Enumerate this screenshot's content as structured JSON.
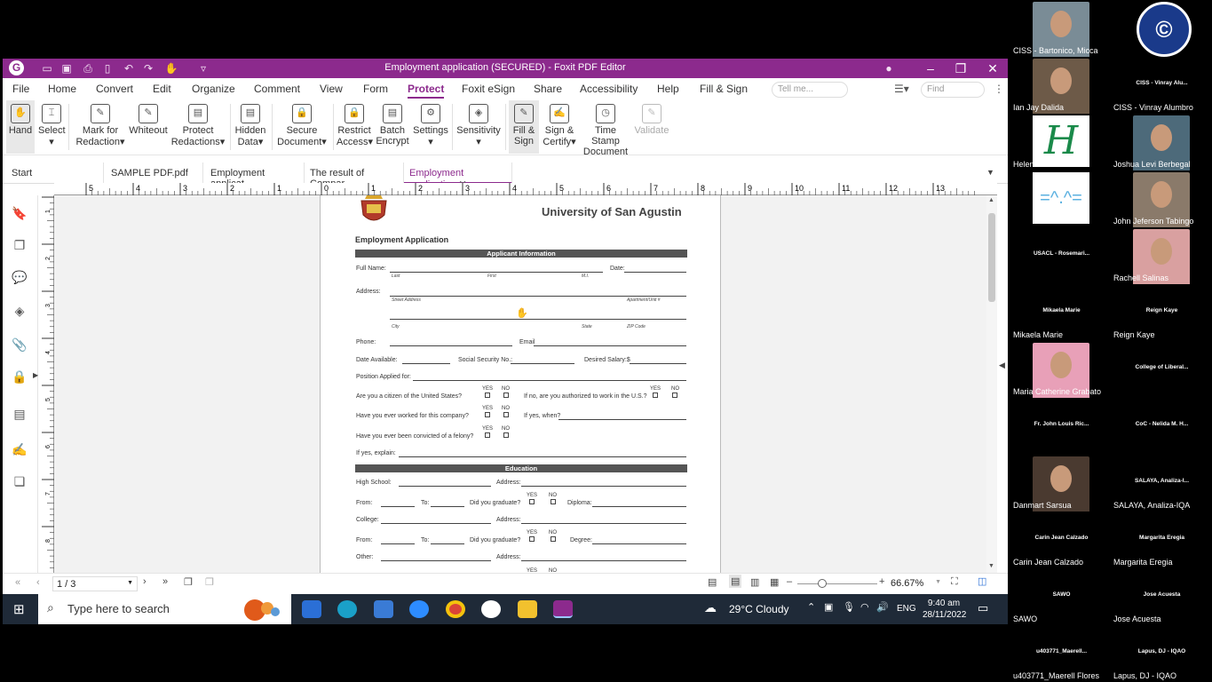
{
  "window": {
    "title": "Employment application (SECURED) - Foxit PDF Editor"
  },
  "menu": [
    "File",
    "Home",
    "Convert",
    "Edit",
    "Organize",
    "Comment",
    "View",
    "Form",
    "Protect",
    "Foxit eSign",
    "Share",
    "Accessibility",
    "Help",
    "Fill & Sign"
  ],
  "menu_active": "Protect",
  "tell_me": "Tell me...",
  "find": "Find",
  "ribbon": [
    {
      "l1": "Hand",
      "l2": ""
    },
    {
      "l1": "Select",
      "l2": "▾"
    },
    {
      "l1": "Mark for",
      "l2": "Redaction▾"
    },
    {
      "l1": "Whiteout",
      "l2": ""
    },
    {
      "l1": "Protect",
      "l2": "Redactions▾"
    },
    {
      "l1": "Hidden",
      "l2": "Data▾"
    },
    {
      "l1": "Secure",
      "l2": "Document▾"
    },
    {
      "l1": "Restrict",
      "l2": "Access▾"
    },
    {
      "l1": "Batch",
      "l2": "Encrypt"
    },
    {
      "l1": "Settings",
      "l2": "▾"
    },
    {
      "l1": "Sensitivity",
      "l2": "▾"
    },
    {
      "l1": "Fill &",
      "l2": "Sign"
    },
    {
      "l1": "Sign &",
      "l2": "Certify▾"
    },
    {
      "l1": "Time Stamp",
      "l2": "Document"
    },
    {
      "l1": "Validate",
      "l2": ""
    }
  ],
  "tabs": [
    "Start",
    "SAMPLE PDF.pdf",
    "Employment applicat...",
    "The result of Compar...",
    "Employment applicati..."
  ],
  "ruler_h": [
    "5",
    "4",
    "3",
    "2",
    "1",
    "0",
    "1",
    "2",
    "3",
    "4",
    "5",
    "6",
    "7",
    "8",
    "9",
    "10",
    "11",
    "12",
    "13"
  ],
  "ruler_v": [
    "1",
    "2",
    "3",
    "4",
    "5",
    "6",
    "7",
    "8"
  ],
  "form": {
    "university": "University of San Agustin",
    "heading": "Employment Application",
    "sec_applicant": "Applicant Information",
    "full_name": "Full Name:",
    "date": "Date:",
    "last": "Last",
    "first": "First",
    "mi": "M.I.",
    "address": "Address:",
    "street": "Street Address",
    "apt": "Apartment/Unit #",
    "city": "City",
    "state": "State",
    "zip": "ZIP Code",
    "phone": "Phone:",
    "email": "Email",
    "date_available": "Date Available:",
    "ssn": "Social Security No.:",
    "salary": "Desired Salary:$",
    "position": "Position Applied for:",
    "citizen": "Are you a citizen of the United States?",
    "authorized": "If no, are you authorized to work in the U.S.?",
    "worked": "Have you ever worked for this company?",
    "if_when": "If yes, when?",
    "felony": "Have you ever been convicted of a felony?",
    "explain": "If yes, explain:",
    "yes": "YES",
    "no": "NO",
    "sec_education": "Education",
    "high_school": "High School:",
    "college": "College:",
    "other": "Other:",
    "addr": "Address:",
    "from": "From:",
    "to": "To:",
    "graduate": "Did you graduate?",
    "diploma": "Diploma:",
    "degree": "Degree:"
  },
  "status": {
    "page": "1 / 3",
    "zoom": "66.67%"
  },
  "taskbar": {
    "search": "Type here to search",
    "weather": "29°C  Cloudy",
    "lang": "ENG",
    "time": "9:40 am",
    "date": "28/11/2022"
  },
  "participants": [
    {
      "name": "CISS - Bartonico, Micca",
      "type": "video"
    },
    {
      "name": "",
      "type": "logo"
    },
    {
      "name": "Ian Jay Dalida",
      "type": "video"
    },
    {
      "name": "CISS - Vinray Alumbro",
      "type": "label",
      "short": "CISS - Vinray Alu..."
    },
    {
      "name": "Helen Grace Besonia",
      "type": "h"
    },
    {
      "name": "Joshua Levi Berbegal",
      "type": "video"
    },
    {
      "name": "",
      "type": "cat"
    },
    {
      "name": "John Jeferson Tabingo",
      "type": "video"
    },
    {
      "name": "",
      "type": "label",
      "short": "USACL - Rosemari..."
    },
    {
      "name": "Rachell Salinas",
      "type": "video"
    },
    {
      "name": "Mikaela Marie",
      "type": "label",
      "short": "Mikaela Marie"
    },
    {
      "name": "Reign Kaye",
      "type": "label",
      "short": "Reign Kaye"
    },
    {
      "name": "Maria Catherine Grabato",
      "type": "video"
    },
    {
      "name": "",
      "type": "label",
      "short": "College of Liberal..."
    },
    {
      "name": "",
      "type": "label",
      "short": "Fr. John Louis Ric..."
    },
    {
      "name": "",
      "type": "label",
      "short": "CoC - Nelida M. H..."
    },
    {
      "name": "Danmart Sarsua",
      "type": "video"
    },
    {
      "name": "SALAYA, Analiza-IQA",
      "type": "label",
      "short": "SALAYA, Analiza-I..."
    },
    {
      "name": "Carin Jean Calzado",
      "type": "label",
      "short": "Carin Jean Calzado"
    },
    {
      "name": "Margarita Eregia",
      "type": "label",
      "short": "Margarita Eregia"
    },
    {
      "name": "SAWO",
      "type": "label",
      "short": "SAWO"
    },
    {
      "name": "Jose Acuesta",
      "type": "label",
      "short": "Jose Acuesta"
    },
    {
      "name": "u403771_Maerell Flores",
      "type": "label",
      "short": "u403771_Maerell..."
    },
    {
      "name": "Lapus, DJ - IQAO",
      "type": "label",
      "short": "Lapus, DJ - IQAO"
    }
  ],
  "colors": {
    "brand": "#8c2a8d",
    "taskbar": "#1f2a38"
  }
}
